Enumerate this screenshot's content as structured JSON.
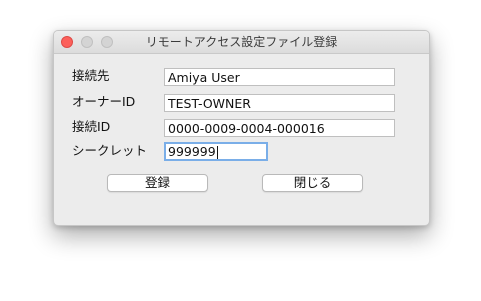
{
  "window": {
    "title": "リモートアクセス設定ファイル登録"
  },
  "fields": [
    {
      "label": "接続先",
      "value": "Amiya User"
    },
    {
      "label": "オーナーID",
      "value": "TEST-OWNER"
    },
    {
      "label": "接続ID",
      "value": "0000-0009-0004-000016"
    },
    {
      "label": "シークレット",
      "value": "999999"
    }
  ],
  "buttons": {
    "register_label": "登録",
    "close_label": "閉じる"
  },
  "colors": {
    "window_bg": "#ececec",
    "close_light": "#fc605b",
    "focus_ring": "#7aaee8"
  }
}
